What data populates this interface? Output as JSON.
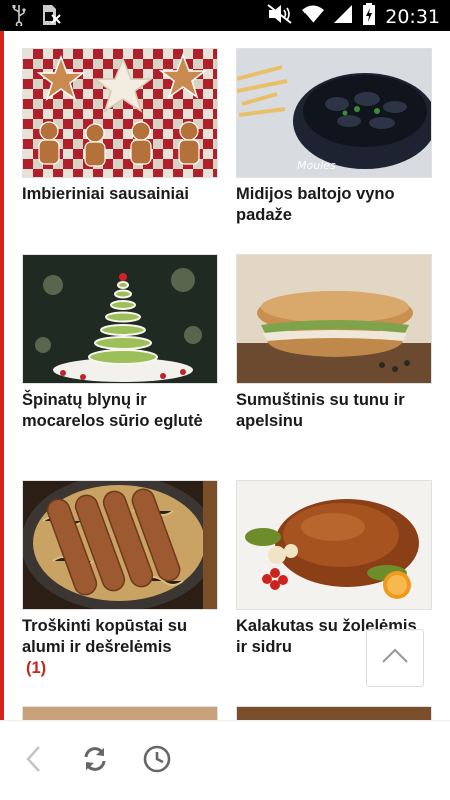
{
  "status_bar": {
    "time": "20:31",
    "icons": [
      "usb-icon",
      "no-sim-icon",
      "mute-icon",
      "wifi-icon",
      "signal-icon",
      "battery-charging-icon"
    ]
  },
  "recipes": [
    {
      "title": "Imbieriniai sausainiai",
      "count": ""
    },
    {
      "title": "Midijos baltojo vyno padaže",
      "count": ""
    },
    {
      "title": "Špinatų blynų ir mocarelos sūrio eglutė",
      "count": ""
    },
    {
      "title": "Sumuštinis su tunu ir apelsinu",
      "count": ""
    },
    {
      "title": "Troškinti kopūstai su alumi ir dešrelėmis",
      "count": "(1)"
    },
    {
      "title": "Kalakutas su žolelėmis ir sidru",
      "count": ""
    }
  ],
  "toolbar": {
    "back_icon": "chevron-left-icon",
    "refresh_icon": "refresh-icon",
    "history_icon": "clock-icon"
  },
  "scroll_top_icon": "chevron-up-icon",
  "colors": {
    "accent_red": "#d9221a",
    "count_red": "#c8261d"
  }
}
